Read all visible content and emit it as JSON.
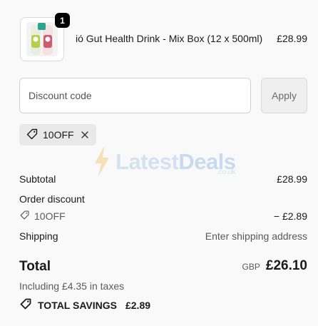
{
  "product": {
    "name": "ió Gut Health Drink - Mix Box (12 x 500ml)",
    "price": "£28.99",
    "quantity": "1",
    "image_icon": "drink-bottles-image"
  },
  "discount": {
    "placeholder": "Discount code",
    "apply_label": "Apply",
    "applied_code": "10OFF"
  },
  "summary": {
    "subtotal_label": "Subtotal",
    "subtotal_value": "£28.99",
    "order_discount_label": "Order discount",
    "discount_code": "10OFF",
    "discount_value": "− £2.89",
    "shipping_label": "Shipping",
    "shipping_value": "Enter shipping address",
    "total_label": "Total",
    "total_currency": "GBP",
    "total_value": "£26.10",
    "tax_note": "Including £4.35 in taxes",
    "savings_label": "TOTAL SAVINGS",
    "savings_value": "£2.89"
  },
  "watermark": {
    "word1": "Latest",
    "word2": "Deals",
    "suffix": ".co.uk"
  },
  "colors": {
    "background": "#f9f9f9",
    "badge": "#000000",
    "chip": "#e9e9e9",
    "apply_button": "#efefef"
  }
}
